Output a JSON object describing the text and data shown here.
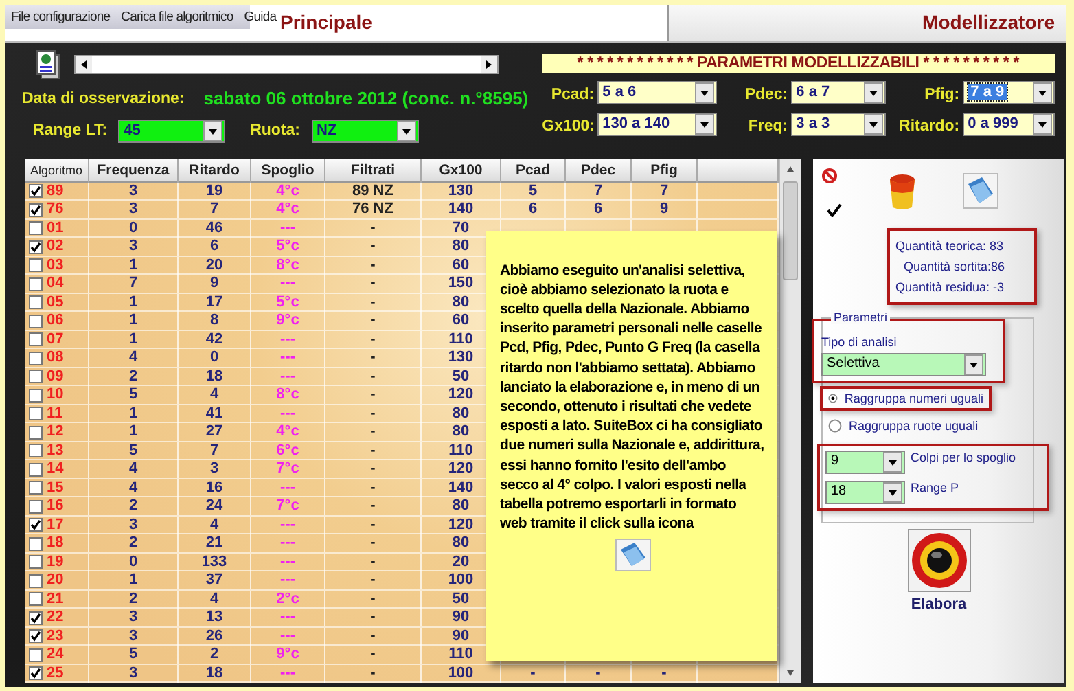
{
  "menu": [
    "File configurazione",
    "Carica file algoritmico",
    "Guida"
  ],
  "tabs": [
    {
      "label": "Principale",
      "selected": false
    },
    {
      "label": "Modellizzatore",
      "selected": true
    }
  ],
  "observation": {
    "label": "Data di osservazione:",
    "value": "sabato 06 ottobre 2012 (conc. n.°8595)"
  },
  "filters": [
    {
      "label": "Range LT:",
      "value": "45"
    },
    {
      "label": "Ruota:",
      "value": "NZ"
    }
  ],
  "params_title": "* * * * * * * * * * * * PARAMETRI MODELLIZZABILI * * * * * * * * * *",
  "params": [
    {
      "label": "Pcad:",
      "value": "5 a 6",
      "selected": false
    },
    {
      "label": "Pdec:",
      "value": "6 a 7",
      "selected": false
    },
    {
      "label": "Pfig:",
      "value": "7 a 9",
      "selected": true
    },
    {
      "label": "Gx100:",
      "value": "130 a 140",
      "selected": false
    },
    {
      "label": "Freq:",
      "value": "3 a 3",
      "selected": false
    },
    {
      "label": "Ritardo:",
      "value": "0 a 999",
      "selected": false
    }
  ],
  "table": {
    "columns": [
      "Algoritmo",
      "Frequenza",
      "Ritardo",
      "Spoglio",
      "Filtrati",
      "Gx100",
      "Pcad",
      "Pdec",
      "Pfig"
    ],
    "rows": [
      {
        "algo": "89",
        "checked": true,
        "freq": "3",
        "rit": "19",
        "spoglio": "4°c",
        "filtrati": "89 NZ",
        "gx": "130",
        "pcad": "5",
        "pdec": "7",
        "pfig": "7"
      },
      {
        "algo": "76",
        "checked": true,
        "freq": "3",
        "rit": "7",
        "spoglio": "4°c",
        "filtrati": "76 NZ",
        "gx": "140",
        "pcad": "6",
        "pdec": "6",
        "pfig": "9"
      },
      {
        "algo": "01",
        "checked": false,
        "freq": "0",
        "rit": "46",
        "spoglio": "---",
        "filtrati": "-",
        "gx": "70"
      },
      {
        "algo": "02",
        "checked": true,
        "freq": "3",
        "rit": "6",
        "spoglio": "5°c",
        "filtrati": "-",
        "gx": "80"
      },
      {
        "algo": "03",
        "checked": false,
        "freq": "1",
        "rit": "20",
        "spoglio": "8°c",
        "filtrati": "-",
        "gx": "60"
      },
      {
        "algo": "04",
        "checked": false,
        "freq": "7",
        "rit": "9",
        "spoglio": "---",
        "filtrati": "-",
        "gx": "150"
      },
      {
        "algo": "05",
        "checked": false,
        "freq": "1",
        "rit": "17",
        "spoglio": "5°c",
        "filtrati": "-",
        "gx": "80"
      },
      {
        "algo": "06",
        "checked": false,
        "freq": "1",
        "rit": "8",
        "spoglio": "9°c",
        "filtrati": "-",
        "gx": "60"
      },
      {
        "algo": "07",
        "checked": false,
        "freq": "1",
        "rit": "42",
        "spoglio": "---",
        "filtrati": "-",
        "gx": "110"
      },
      {
        "algo": "08",
        "checked": false,
        "freq": "4",
        "rit": "0",
        "spoglio": "---",
        "filtrati": "-",
        "gx": "130"
      },
      {
        "algo": "09",
        "checked": false,
        "freq": "2",
        "rit": "18",
        "spoglio": "---",
        "filtrati": "-",
        "gx": "50"
      },
      {
        "algo": "10",
        "checked": false,
        "freq": "5",
        "rit": "4",
        "spoglio": "8°c",
        "filtrati": "-",
        "gx": "120"
      },
      {
        "algo": "11",
        "checked": false,
        "freq": "1",
        "rit": "41",
        "spoglio": "---",
        "filtrati": "-",
        "gx": "80"
      },
      {
        "algo": "12",
        "checked": false,
        "freq": "1",
        "rit": "27",
        "spoglio": "4°c",
        "filtrati": "-",
        "gx": "80"
      },
      {
        "algo": "13",
        "checked": false,
        "freq": "5",
        "rit": "7",
        "spoglio": "6°c",
        "filtrati": "-",
        "gx": "110"
      },
      {
        "algo": "14",
        "checked": false,
        "freq": "4",
        "rit": "3",
        "spoglio": "7°c",
        "filtrati": "-",
        "gx": "120"
      },
      {
        "algo": "15",
        "checked": false,
        "freq": "4",
        "rit": "16",
        "spoglio": "---",
        "filtrati": "-",
        "gx": "140"
      },
      {
        "algo": "16",
        "checked": false,
        "freq": "2",
        "rit": "24",
        "spoglio": "7°c",
        "filtrati": "-",
        "gx": "80"
      },
      {
        "algo": "17",
        "checked": true,
        "freq": "3",
        "rit": "4",
        "spoglio": "---",
        "filtrati": "-",
        "gx": "120"
      },
      {
        "algo": "18",
        "checked": false,
        "freq": "2",
        "rit": "21",
        "spoglio": "---",
        "filtrati": "-",
        "gx": "80"
      },
      {
        "algo": "19",
        "checked": false,
        "freq": "0",
        "rit": "133",
        "spoglio": "---",
        "filtrati": "-",
        "gx": "20"
      },
      {
        "algo": "20",
        "checked": false,
        "freq": "1",
        "rit": "37",
        "spoglio": "---",
        "filtrati": "-",
        "gx": "100"
      },
      {
        "algo": "21",
        "checked": false,
        "freq": "2",
        "rit": "4",
        "spoglio": "2°c",
        "filtrati": "-",
        "gx": "50"
      },
      {
        "algo": "22",
        "checked": true,
        "freq": "3",
        "rit": "13",
        "spoglio": "---",
        "filtrati": "-",
        "gx": "90"
      },
      {
        "algo": "23",
        "checked": true,
        "freq": "3",
        "rit": "26",
        "spoglio": "---",
        "filtrati": "-",
        "gx": "90"
      },
      {
        "algo": "24",
        "checked": false,
        "freq": "5",
        "rit": "2",
        "spoglio": "9°c",
        "filtrati": "-",
        "gx": "110"
      },
      {
        "algo": "25",
        "checked": true,
        "freq": "3",
        "rit": "18",
        "spoglio": "---",
        "filtrati": "-",
        "gx": "100",
        "pcad": "-",
        "pdec": "-",
        "pfig": "-"
      }
    ]
  },
  "note": {
    "text": "Abbiamo eseguito un'analisi selettiva, cioè abbiamo selezionato la ruota e scelto quella della Nazionale. Abbiamo inserito parametri personali nelle caselle Pcd, Pfig, Pdec, Punto G Freq (la casella ritardo non l'abbiamo settata). Abbiamo lanciato la elaborazione e, in meno di un secondo, ottenuto i risultati che vedete esposti a lato. SuiteBox ci ha consigliato due numeri sulla Nazionale e, addirittura, essi hanno fornito l'esito dell'ambo secco al 4° colpo. I valori esposti nella tabella potremo esportarli in formato web tramite il click sulla icona"
  },
  "side": {
    "quantities": [
      "Quantità teorica: 83",
      "Quantità sortita:86",
      "Quantità residua: -3"
    ],
    "legend": "Parametri",
    "analysis_label": "Tipo di analisi",
    "analysis_value": "Selettiva",
    "grouping": [
      {
        "label": "Raggruppa numeri uguali",
        "selected": true
      },
      {
        "label": "Raggruppa ruote uguali",
        "selected": false
      }
    ],
    "spoglio": [
      {
        "value": "9",
        "label": "Colpi per lo spoglio"
      },
      {
        "value": "18",
        "label": "Range P"
      }
    ],
    "action": "Elabora"
  }
}
